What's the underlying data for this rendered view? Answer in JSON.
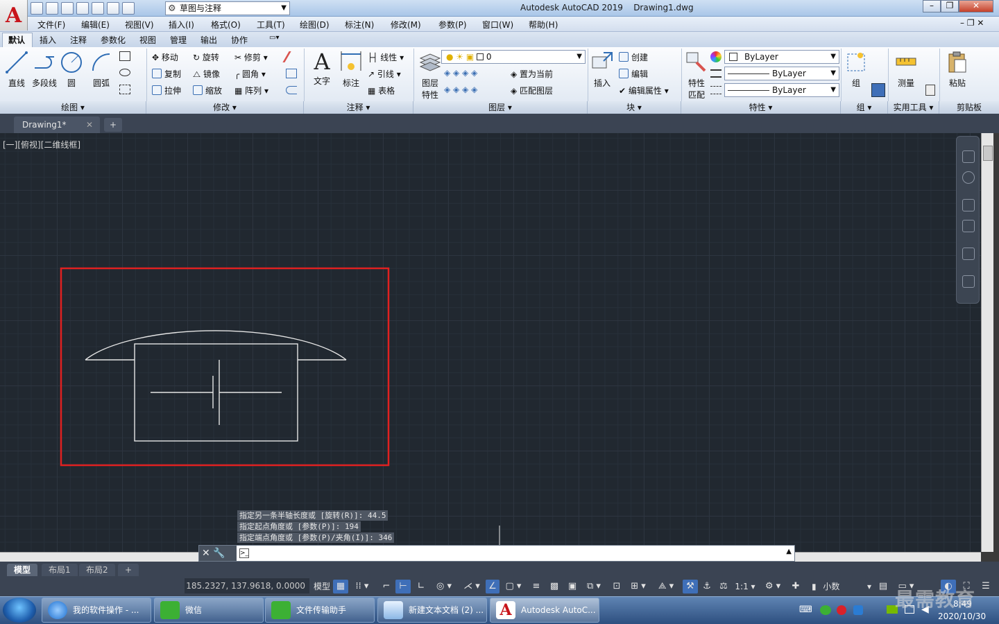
{
  "titlebar": {
    "app": "Autodesk AutoCAD 2019",
    "file": "Drawing1.dwg",
    "workspace": "草图与注释"
  },
  "menu": [
    "文件(F)",
    "编辑(E)",
    "视图(V)",
    "插入(I)",
    "格式(O)",
    "工具(T)",
    "绘图(D)",
    "标注(N)",
    "修改(M)",
    "参数(P)",
    "窗口(W)",
    "帮助(H)"
  ],
  "ribbon_tabs": [
    "默认",
    "插入",
    "注释",
    "参数化",
    "视图",
    "管理",
    "输出",
    "协作"
  ],
  "panels": {
    "draw": {
      "title": "绘图",
      "line": "直线",
      "polyline": "多段线",
      "circle": "圆",
      "arc": "圆弧"
    },
    "modify": {
      "title": "修改",
      "move": "移动",
      "rotate": "旋转",
      "trim": "修剪",
      "copy": "复制",
      "mirror": "镜像",
      "fillet": "圆角",
      "stretch": "拉伸",
      "scale": "缩放",
      "array": "阵列"
    },
    "annotation": {
      "title": "注释",
      "text": "文字",
      "dimension": "标注",
      "linear": "线性",
      "leader": "引线",
      "table": "表格"
    },
    "layers": {
      "title": "图层",
      "props_line1": "图层",
      "props_line2": "特性",
      "layer_value": "0",
      "set_current": "置为当前",
      "match_layer": "匹配图层"
    },
    "block": {
      "title": "块",
      "insert": "插入",
      "create": "创建",
      "edit": "编辑",
      "edit_attr": "编辑属性"
    },
    "properties": {
      "title": "特性",
      "match_line1": "特性",
      "match_line2": "匹配",
      "color": "ByLayer",
      "linetype": "ByLayer",
      "lineweight": "ByLayer"
    },
    "groups": {
      "title": "组",
      "group": "组"
    },
    "utilities": {
      "title": "实用工具",
      "measure": "测量"
    },
    "clipboard": {
      "title": "剪贴板",
      "paste": "粘贴"
    }
  },
  "document_tab": "Drawing1*",
  "viewport_label": "[一][俯视][二维线框]",
  "command_history": [
    "指定另一条半轴长度或 [旋转(R)]: 44.5",
    "指定起点角度或 [参数(P)]: 194",
    "指定端点角度或 [参数(P)/夹角(I)]: 346"
  ],
  "command_input": "",
  "layout_tabs": [
    "模型",
    "布局1",
    "布局2"
  ],
  "status": {
    "coords": "185.2327, 137.9618, 0.0000",
    "model": "模型",
    "scale": "1:1",
    "units": "小数"
  },
  "taskbar": {
    "items": [
      "我的软件操作 - ...",
      "微信",
      "文件传输助手",
      "新建文本文档 (2) ...",
      "Autodesk AutoC..."
    ],
    "time": "8:49",
    "date": "2020/10/30"
  },
  "watermark": "最需教育",
  "colors": {
    "canvas": "#212830",
    "highlight": "#e02020",
    "drawing": "#e6e6e6"
  }
}
